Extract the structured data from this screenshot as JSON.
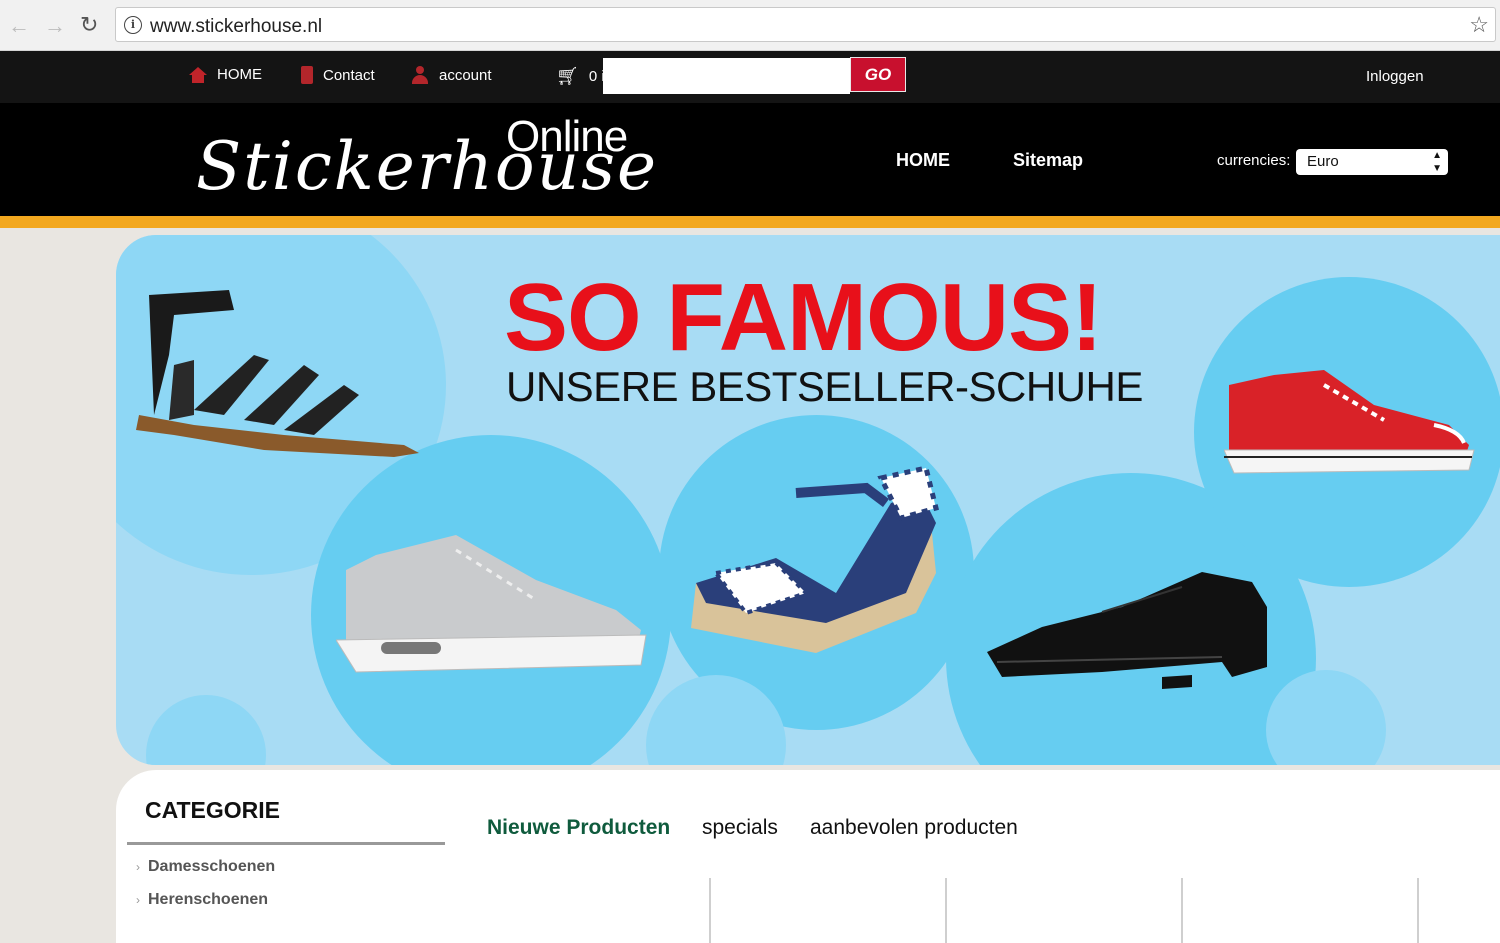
{
  "browser": {
    "url": "www.stickerhouse.nl"
  },
  "topbar": {
    "home": "HOME",
    "contact": "Contact",
    "account": "account",
    "cart_count": "0 i",
    "search_value": "",
    "go": "GO",
    "login": "Inloggen"
  },
  "header": {
    "logo_top": "Online",
    "logo_main": "Stickerhouse",
    "nav": [
      "HOME",
      "Sitemap"
    ],
    "currencies_label": "currencies:",
    "currency_selected": "Euro"
  },
  "banner": {
    "title": "SO FAMOUS!",
    "subtitle": "UNSERE BESTSELLER-SCHUHE",
    "products": [
      "sandal",
      "sneaker",
      "wedge-sandal",
      "oxford-shoe",
      "red-canvas-sneaker"
    ]
  },
  "sidebar": {
    "title": "CATEGORIE",
    "items": [
      "Damesschoenen",
      "Herenschoenen"
    ]
  },
  "tabs": [
    "Nieuwe Producten",
    "specials",
    "aanbevolen producten"
  ],
  "colors": {
    "accent": "#f3a81f",
    "brand_red": "#c8102e",
    "banner_bg": "#a8dcf4",
    "active_tab": "#0f5b3d"
  }
}
